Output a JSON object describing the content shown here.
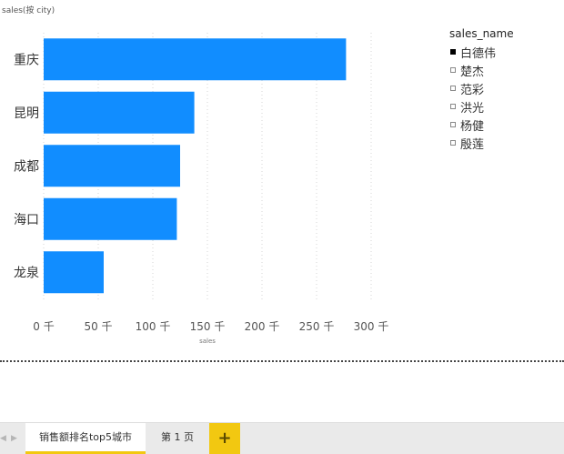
{
  "chart_data": {
    "type": "bar",
    "orientation": "horizontal",
    "title": "sales(按 city)",
    "xlabel": "sales",
    "ylabel": "",
    "categories": [
      "重庆",
      "昆明",
      "成都",
      "海口",
      "龙泉"
    ],
    "values": [
      277000,
      138000,
      125000,
      122000,
      55000
    ],
    "xlim": [
      0,
      300000
    ],
    "xticks": [
      0,
      50000,
      100000,
      150000,
      200000,
      250000,
      300000
    ],
    "xtick_labels": [
      "0 千",
      "50 千",
      "100 千",
      "150 千",
      "200 千",
      "250 千",
      "300 千"
    ],
    "bar_color": "#118dff",
    "grid": "vertical dotted",
    "legend_position": "right"
  },
  "legend": {
    "title": "sales_name",
    "items": [
      {
        "label": "白德伟",
        "selected": true
      },
      {
        "label": "楚杰",
        "selected": false
      },
      {
        "label": "范彩",
        "selected": false
      },
      {
        "label": "洪光",
        "selected": false
      },
      {
        "label": "杨健",
        "selected": false
      },
      {
        "label": "殷莲",
        "selected": false
      }
    ]
  },
  "tabs": {
    "prev_icon": "chevron-left-icon",
    "next_icon": "chevron-right-icon",
    "items": [
      {
        "label": "销售额排名top5城市",
        "active": true
      },
      {
        "label": "第 1 页",
        "active": false
      }
    ],
    "add_label": "+"
  },
  "colors": {
    "accent": "#f2c811",
    "bar": "#118dff"
  }
}
